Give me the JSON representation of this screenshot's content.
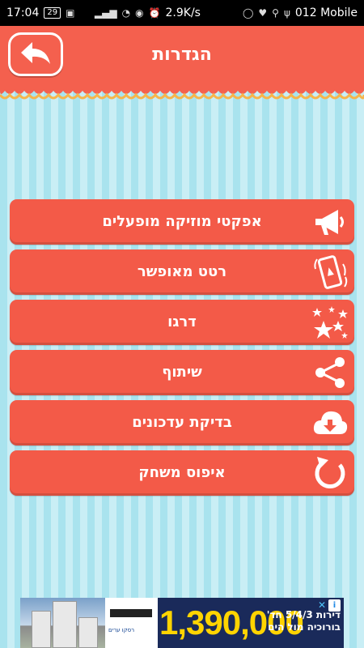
{
  "status_bar": {
    "time": "17:04",
    "battery_level": "29",
    "speed": "2.9K/s",
    "carrier": "012 Mobile"
  },
  "header": {
    "title": "הגדרות",
    "back_icon": "back-arrow-icon"
  },
  "menu": {
    "items": [
      {
        "label": "אפקטי מוזיקה מופעלים",
        "icon": "megaphone-icon"
      },
      {
        "label": "רטט מאופשר",
        "icon": "vibrating-phone-icon"
      },
      {
        "label": "דרגו",
        "icon": "stars-icon"
      },
      {
        "label": "שיתוף",
        "icon": "share-icon"
      },
      {
        "label": "בדיקת עדכונים",
        "icon": "cloud-download-icon"
      },
      {
        "label": "איפוס משחק",
        "icon": "refresh-icon"
      }
    ]
  },
  "ad": {
    "price": "1,390,000",
    "line1": "דירות 5/4/3 חד'",
    "line2": "בורוכיה מול הים",
    "advertiser": "רסקו ערים"
  },
  "colors": {
    "accent": "#f35a48",
    "stripe_light": "#c9eef5",
    "stripe_dark": "#a9e3ee"
  }
}
